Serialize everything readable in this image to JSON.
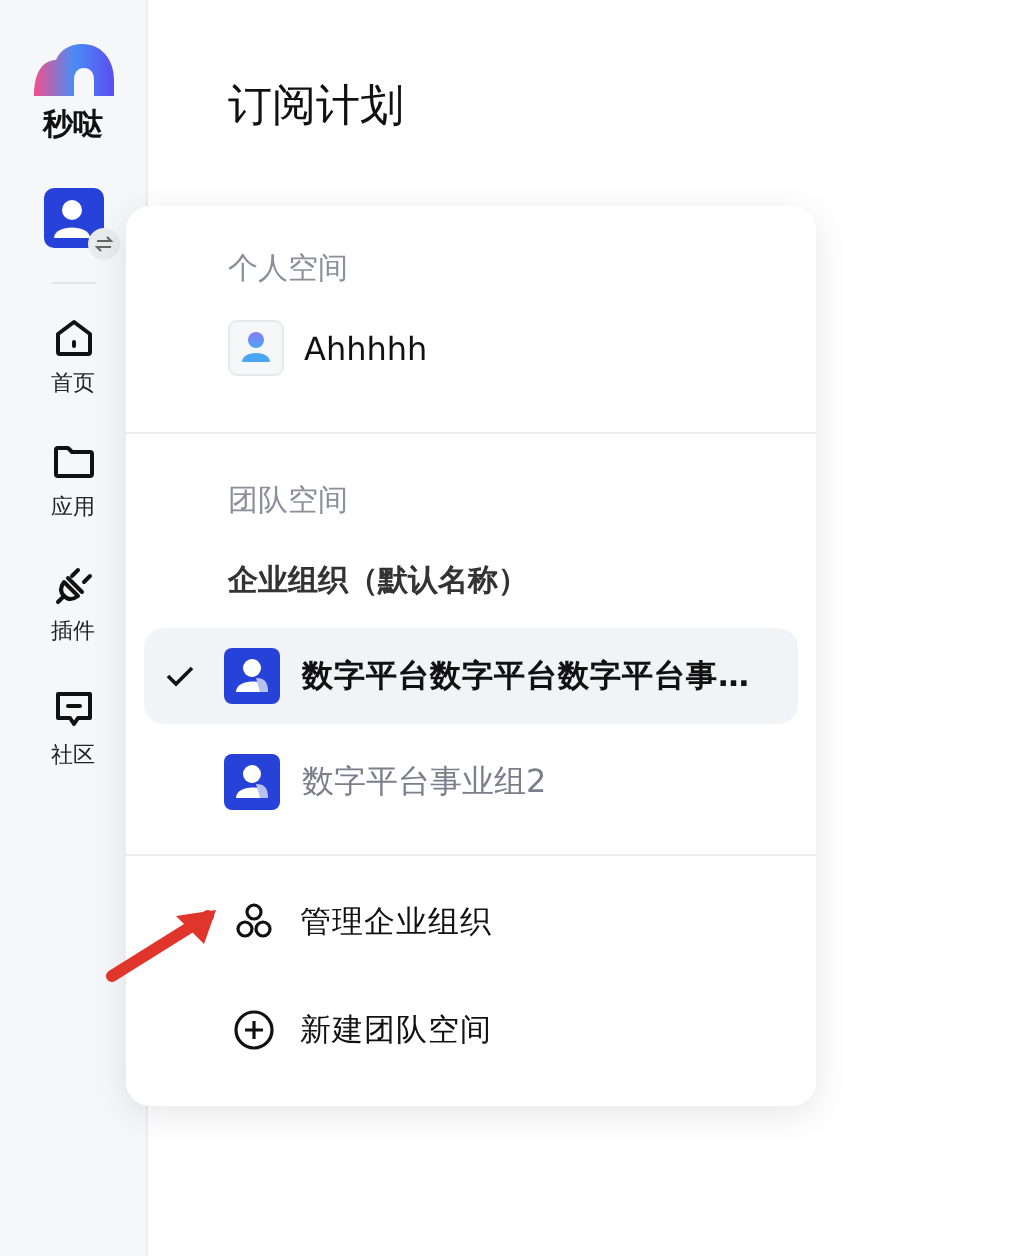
{
  "app": {
    "name": "秒哒"
  },
  "nav": [
    {
      "label": "首页",
      "kind": "home"
    },
    {
      "label": "应用",
      "kind": "folder"
    },
    {
      "label": "插件",
      "kind": "plug"
    },
    {
      "label": "社区",
      "kind": "chat"
    }
  ],
  "page": {
    "title": "订阅计划"
  },
  "menu": {
    "personal": {
      "heading": "个人空间",
      "user": "Ahhhhh"
    },
    "team": {
      "heading": "团队空间",
      "org": "企业组织（默认名称）",
      "spaces": [
        {
          "name": "数字平台数字平台数字平台事…",
          "selected": true
        },
        {
          "name": "数字平台事业组2",
          "selected": false
        }
      ]
    },
    "actions": [
      {
        "label": "管理企业组织",
        "kind": "org"
      },
      {
        "label": "新建团队空间",
        "kind": "add"
      }
    ]
  }
}
